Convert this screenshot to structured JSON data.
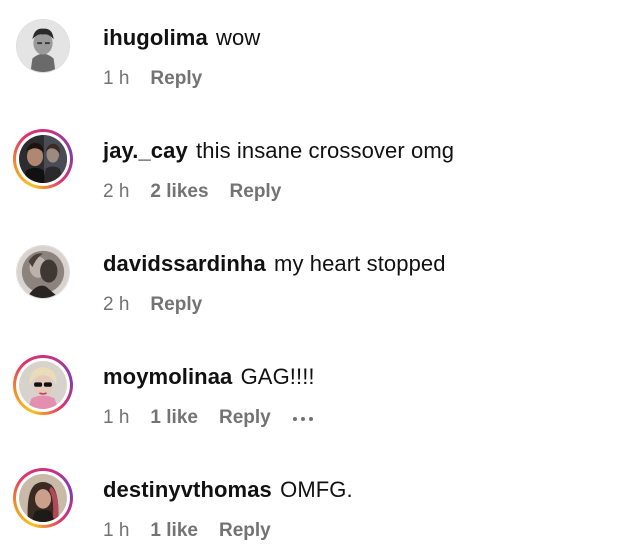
{
  "comments": [
    {
      "username": "ihugolima",
      "text": "wow",
      "time": "1 h",
      "likes": "",
      "reply": "Reply",
      "story_ring": false,
      "show_more": false
    },
    {
      "username": "jay._cay",
      "text": "this insane crossover omg",
      "time": "2 h",
      "likes": "2 likes",
      "reply": "Reply",
      "story_ring": true,
      "show_more": false
    },
    {
      "username": "davidssardinha",
      "text": "my heart stopped",
      "time": "2 h",
      "likes": "",
      "reply": "Reply",
      "story_ring": false,
      "show_more": false
    },
    {
      "username": "moymolinaa",
      "text": "GAG!!!!",
      "time": "1 h",
      "likes": "1 like",
      "reply": "Reply",
      "story_ring": true,
      "show_more": true
    },
    {
      "username": "destinyvthomas",
      "text": "OMFG.",
      "time": "1 h",
      "likes": "1 like",
      "reply": "Reply",
      "story_ring": true,
      "show_more": false
    }
  ],
  "icons": {
    "more": "more-options-icon"
  },
  "colors": {
    "text": "#111111",
    "meta": "#737373",
    "ring_gradient": [
      "#f8c31d",
      "#f38a2a",
      "#e1306c",
      "#c13584",
      "#833ab4"
    ]
  }
}
